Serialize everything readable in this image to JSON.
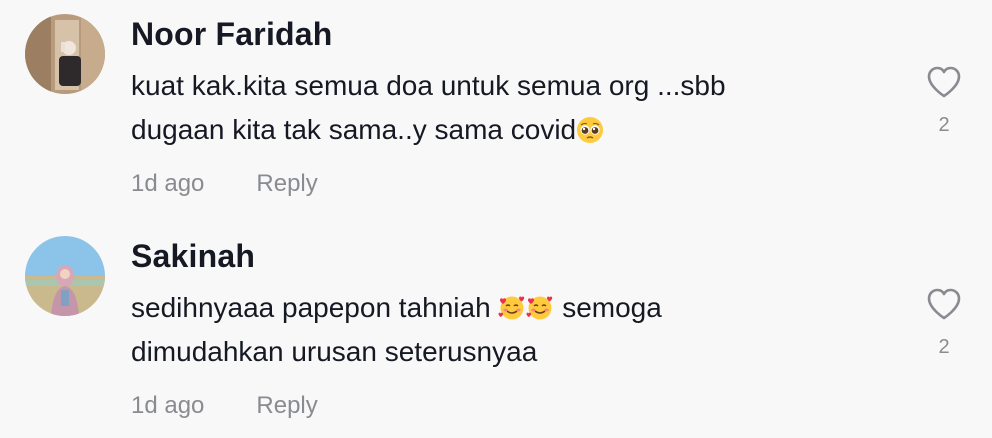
{
  "comments": [
    {
      "username": "Noor Faridah",
      "text_line1": "kuat kak.kita semua doa untuk semua org ...sbb",
      "text_line2": "dugaan kita tak sama..y sama covid",
      "emoji": "pleading-face-emoji",
      "time": "1d ago",
      "reply_label": "Reply",
      "like_icon": "heart-outline-icon",
      "like_count": "2"
    },
    {
      "username": "Sakinah",
      "text_line1_before": "sedihnyaaa papepon tahniah ",
      "emojis": [
        "smiling-face-with-hearts-emoji",
        "smiling-face-with-hearts-emoji"
      ],
      "text_line1_after": " semoga",
      "text_line2": "dimudahkan urusan seterusnyaa",
      "time": "1d ago",
      "reply_label": "Reply",
      "like_icon": "heart-outline-icon",
      "like_count": "2"
    }
  ],
  "colors": {
    "background": "#f8f8f8",
    "username": "#161823",
    "text": "#161823",
    "meta": "#8a8b91",
    "heart_stroke": "#8a8b91"
  }
}
